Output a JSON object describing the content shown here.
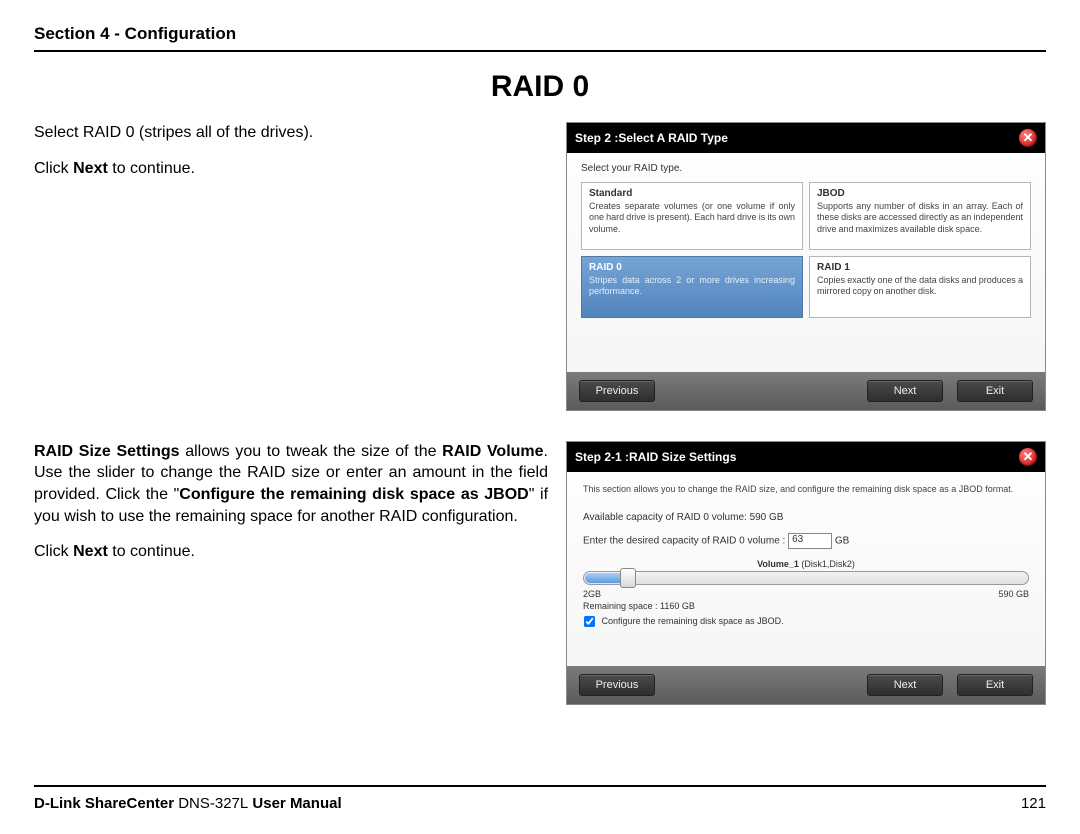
{
  "header": {
    "section": "Section 4 - Configuration"
  },
  "title": "RAID 0",
  "block1": {
    "line1": "Select RAID 0 (stripes all of the drives).",
    "line2a": "Click ",
    "line2b": "Next",
    "line2c": " to continue."
  },
  "block2": {
    "p1a": "RAID Size Settings",
    "p1b": " allows you to tweak the size of the ",
    "p1c": "RAID Volume",
    "p1d": ". Use the slider to change the RAID size or enter an amount in the field provided. Click the \"",
    "p1e": "Configure the remaining disk space as JBOD",
    "p1f": "\" if you wish to use the remaining space for another RAID configuration.",
    "line2a": "Click ",
    "line2b": "Next",
    "line2c": " to continue."
  },
  "panel1": {
    "title": "Step 2 :Select A RAID Type",
    "selectLabel": "Select your RAID type.",
    "cards": {
      "standard": {
        "title": "Standard",
        "desc": "Creates separate volumes (or one volume if only one hard drive is present). Each hard drive is its own volume."
      },
      "jbod": {
        "title": "JBOD",
        "desc": "Supports any number of disks in an array. Each of these disks are accessed directly as an independent drive and maximizes available disk space."
      },
      "raid0": {
        "title": "RAID 0",
        "desc": "Stripes data across 2 or more drives increasing performance."
      },
      "raid1": {
        "title": "RAID 1",
        "desc": "Copies exactly one of the data disks and produces a mirrored copy on another disk."
      }
    },
    "btn": {
      "prev": "Previous",
      "next": "Next",
      "exit": "Exit"
    }
  },
  "panel2": {
    "title": "Step 2-1 :RAID Size Settings",
    "intro": "This section allows you to change the RAID size, and configure the remaining disk space as a JBOD format.",
    "availLabel": "Available capacity of RAID 0 volume: 590 GB",
    "enterLabel": "Enter the desired capacity of RAID 0 volume :",
    "enterValue": "63",
    "enterUnit": "GB",
    "volName": "Volume_1",
    "volDisks": " (Disk1,Disk2)",
    "sliderMin": "2GB",
    "sliderMax": "590 GB",
    "remaining": "Remaining space : 1160 GB",
    "jbodLabel": "Configure the remaining disk space as JBOD.",
    "btn": {
      "prev": "Previous",
      "next": "Next",
      "exit": "Exit"
    }
  },
  "footer": {
    "brand": "D-Link ShareCenter ",
    "model": "DNS-327L",
    "suffix": " User Manual",
    "page": "121"
  }
}
